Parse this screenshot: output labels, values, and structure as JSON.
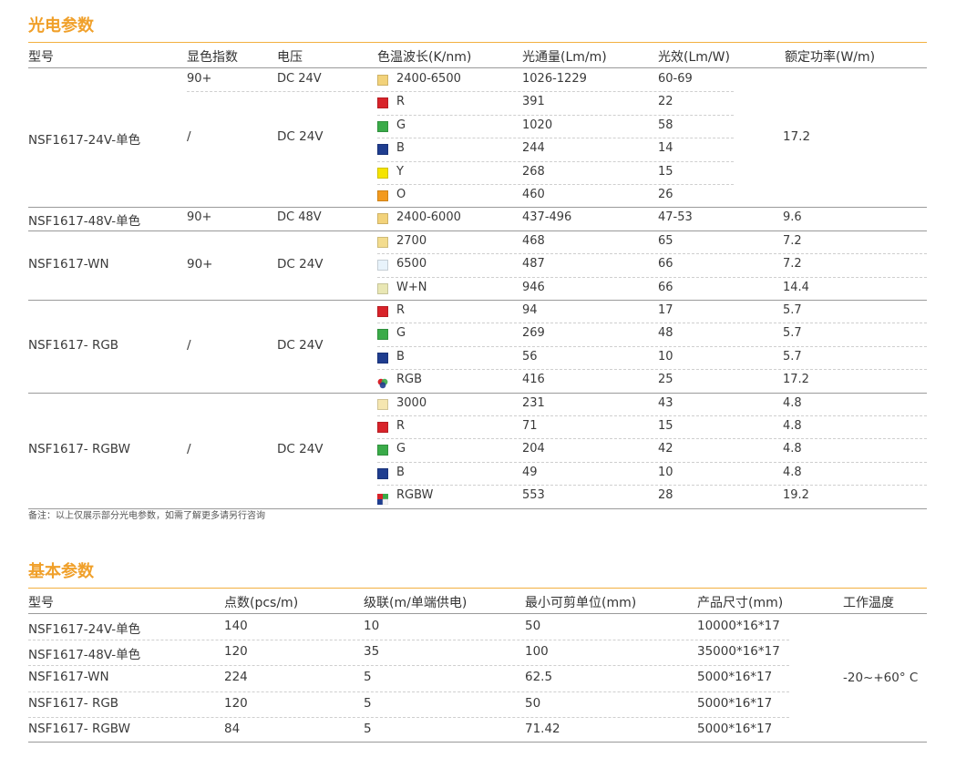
{
  "section1": {
    "title": "光电参数",
    "headers": [
      "型号",
      "显色指数",
      "电压",
      "色温波长(K/nm)",
      "光通量(Lm/m)",
      "光效(Lm/W)",
      "额定功率(W/m)"
    ],
    "groups": [
      {
        "model": "NSF1617-24V-单色",
        "rows": [
          {
            "cri": "90+",
            "voltage": "DC 24V",
            "swatch": "#f2d27a",
            "ct": "2400-6500",
            "flux": "1026-1229",
            "eff": "60-69",
            "power": ""
          },
          {
            "cri": "",
            "voltage": "",
            "swatch": "#d8232a",
            "ct": "R",
            "flux": "391",
            "eff": "22",
            "power": ""
          },
          {
            "cri": "",
            "voltage": "",
            "swatch": "#3aab49",
            "ct": "G",
            "flux": "1020",
            "eff": "58",
            "power": ""
          },
          {
            "cri": "",
            "voltage": "",
            "swatch": "#1f3d8f",
            "ct": "B",
            "flux": "244",
            "eff": "14",
            "power": ""
          },
          {
            "cri": "",
            "voltage": "",
            "swatch": "#f5e400",
            "ct": "Y",
            "flux": "268",
            "eff": "15",
            "power": ""
          },
          {
            "cri": "",
            "voltage": "",
            "swatch": "#f39a1e",
            "ct": "O",
            "flux": "460",
            "eff": "26",
            "power": ""
          }
        ],
        "cri_merged": "/",
        "voltage_merged": "DC 24V",
        "power_merged": "17.2"
      },
      {
        "model": "NSF1617-48V-单色",
        "rows": [
          {
            "cri": "90+",
            "voltage": "DC 48V",
            "swatch": "#f2d27a",
            "ct": "2400-6000",
            "flux": "437-496",
            "eff": "47-53",
            "power": "9.6"
          }
        ]
      },
      {
        "model": "NSF1617-WN",
        "cri_merged": "90+",
        "voltage_merged": "DC 24V",
        "rows": [
          {
            "swatch": "#f3dc8e",
            "ct": "2700",
            "flux": "468",
            "eff": "65",
            "power": "7.2"
          },
          {
            "swatch": "#e8f3fb",
            "ct": "6500",
            "flux": "487",
            "eff": "66",
            "power": "7.2"
          },
          {
            "swatch": "#e9e7b4",
            "ct": "W+N",
            "flux": "946",
            "eff": "66",
            "power": "14.4"
          }
        ]
      },
      {
        "model": "NSF1617- RGB",
        "cri_merged": "/",
        "voltage_merged": "DC 24V",
        "rows": [
          {
            "swatch": "#d8232a",
            "ct": "R",
            "flux": "94",
            "eff": "17",
            "power": "5.7"
          },
          {
            "swatch": "#3aab49",
            "ct": "G",
            "flux": "269",
            "eff": "48",
            "power": "5.7"
          },
          {
            "swatch": "#1f3d8f",
            "ct": "B",
            "flux": "56",
            "eff": "10",
            "power": "5.7"
          },
          {
            "swatch": "rgb",
            "ct": "RGB",
            "flux": "416",
            "eff": "25",
            "power": "17.2"
          }
        ]
      },
      {
        "model": "NSF1617- RGBW",
        "cri_merged": "/",
        "voltage_merged": "DC 24V",
        "rows": [
          {
            "swatch": "#f5e6b0",
            "ct": "3000",
            "flux": "231",
            "eff": "43",
            "power": "4.8"
          },
          {
            "swatch": "#d8232a",
            "ct": "R",
            "flux": "71",
            "eff": "15",
            "power": "4.8"
          },
          {
            "swatch": "#3aab49",
            "ct": "G",
            "flux": "204",
            "eff": "42",
            "power": "4.8"
          },
          {
            "swatch": "#1f3d8f",
            "ct": "B",
            "flux": "49",
            "eff": "10",
            "power": "4.8"
          },
          {
            "swatch": "rgbw",
            "ct": "RGBW",
            "flux": "553",
            "eff": "28",
            "power": "19.2"
          }
        ]
      }
    ],
    "note": "备注：以上仅展示部分光电参数，如需了解更多请另行咨询"
  },
  "section2": {
    "title": "基本参数",
    "headers": [
      "型号",
      "点数(pcs/m)",
      "级联(m/单端供电)",
      "最小可剪单位(mm)",
      "产品尺寸(mm)",
      "工作温度"
    ],
    "rows": [
      {
        "model": "NSF1617-24V-单色",
        "pcs": "140",
        "cascade": "10",
        "cut": "50",
        "size": "10000*16*17"
      },
      {
        "model": "NSF1617-48V-单色",
        "pcs": "120",
        "cascade": "35",
        "cut": "100",
        "size": "35000*16*17"
      },
      {
        "model": "NSF1617-WN",
        "pcs": "224",
        "cascade": "5",
        "cut": "62.5",
        "size": "5000*16*17"
      },
      {
        "model": "NSF1617- RGB",
        "pcs": "120",
        "cascade": "5",
        "cut": "50",
        "size": "5000*16*17"
      },
      {
        "model": "NSF1617- RGBW",
        "pcs": "84",
        "cascade": "5",
        "cut": "71.42",
        "size": "5000*16*17"
      }
    ],
    "temp": "-20~+60° C"
  },
  "colors": {
    "accent": "#f0a02a",
    "rule": "#f2b040",
    "text": "#333333"
  }
}
